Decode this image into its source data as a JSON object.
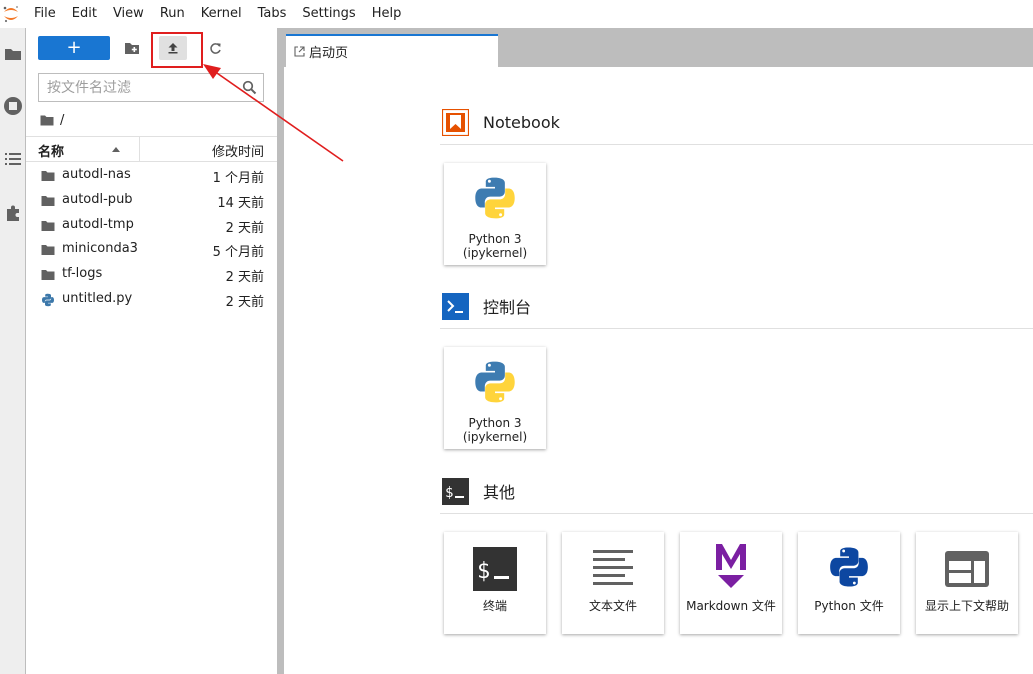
{
  "menubar": {
    "items": [
      "File",
      "Edit",
      "View",
      "Run",
      "Kernel",
      "Tabs",
      "Settings",
      "Help"
    ]
  },
  "filebrowser": {
    "new_label": "+",
    "filter_placeholder": "按文件名过滤",
    "breadcrumb": "/",
    "columns": {
      "name": "名称",
      "modified": "修改时间"
    },
    "files": [
      {
        "name": "autodl-nas",
        "modified": "1 个月前",
        "type": "folder"
      },
      {
        "name": "autodl-pub",
        "modified": "14 天前",
        "type": "folder"
      },
      {
        "name": "autodl-tmp",
        "modified": "2 天前",
        "type": "folder"
      },
      {
        "name": "miniconda3",
        "modified": "5 个月前",
        "type": "folder"
      },
      {
        "name": "tf-logs",
        "modified": "2 天前",
        "type": "folder"
      },
      {
        "name": "untitled.py",
        "modified": "2 天前",
        "type": "python"
      }
    ]
  },
  "main": {
    "tab_label": "启动页",
    "sections": [
      {
        "title": "Notebook",
        "cards": [
          {
            "line1": "Python 3",
            "line2": "(ipykernel)"
          }
        ]
      },
      {
        "title": "控制台",
        "cards": [
          {
            "line1": "Python 3",
            "line2": "(ipykernel)"
          }
        ]
      },
      {
        "title": "其他",
        "cards": [
          {
            "label": "终端"
          },
          {
            "label": "文本文件"
          },
          {
            "label": "Markdown 文件"
          },
          {
            "label": "Python 文件"
          },
          {
            "label": "显示上下文帮助"
          }
        ]
      }
    ]
  },
  "colors": {
    "accent": "#1976d2",
    "annotation": "#e01e1e",
    "notebook_icon": "#e65100",
    "console_icon": "#0d47a1",
    "markdown_icon": "#7b1fa2",
    "terminal_icon": "#333333"
  }
}
